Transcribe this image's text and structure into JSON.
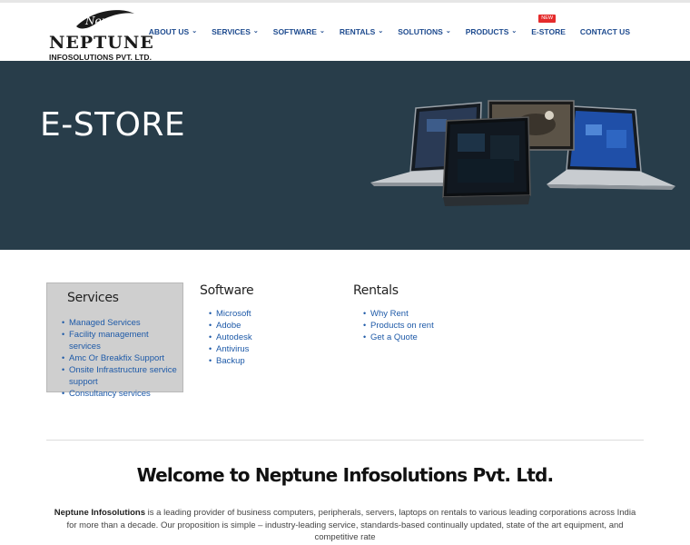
{
  "logo": {
    "script_text": "Neptune",
    "name": "NEPTUNE",
    "subtitle": "INFOSOLUTIONS PVT. LTD."
  },
  "nav": {
    "items": [
      {
        "label": "ABOUT US",
        "dropdown": true
      },
      {
        "label": "SERVICES",
        "dropdown": true
      },
      {
        "label": "SOFTWARE",
        "dropdown": true
      },
      {
        "label": "RENTALS",
        "dropdown": true
      },
      {
        "label": "SOLUTIONS",
        "dropdown": true
      },
      {
        "label": "PRODUCTS",
        "dropdown": true
      },
      {
        "label": "E-STORE",
        "dropdown": false,
        "badge": "NEW"
      },
      {
        "label": "CONTACT US",
        "dropdown": false
      }
    ]
  },
  "hero": {
    "title": "E-STORE",
    "background_color": "#283d4a"
  },
  "menus": {
    "services": {
      "title": "Services",
      "items": [
        "Managed Services",
        "Facility management services",
        "Amc Or Breakfix Support",
        "Onsite Infrastructure service support",
        "Consultancy services"
      ]
    },
    "software": {
      "title": "Software",
      "items": [
        "Microsoft",
        "Adobe",
        "Autodesk",
        "Antivirus",
        "Backup"
      ]
    },
    "rentals": {
      "title": "Rentals",
      "items": [
        "Why Rent",
        "Products on rent",
        "Get a Quote"
      ]
    }
  },
  "welcome": {
    "heading": "Welcome to Neptune Infosolutions Pvt. Ltd.",
    "intro_bold": "Neptune Infosolutions",
    "intro_rest": " is a leading provider of business computers, peripherals, servers, laptops on rentals to various leading corporations across India for more than a decade. Our proposition is simple – industry-leading service, standards-based continually updated, state of the art equipment, and competitive rate"
  },
  "colors": {
    "link": "#1e5aa8",
    "nav": "#1e4b8f",
    "badge": "#e52b2b"
  }
}
